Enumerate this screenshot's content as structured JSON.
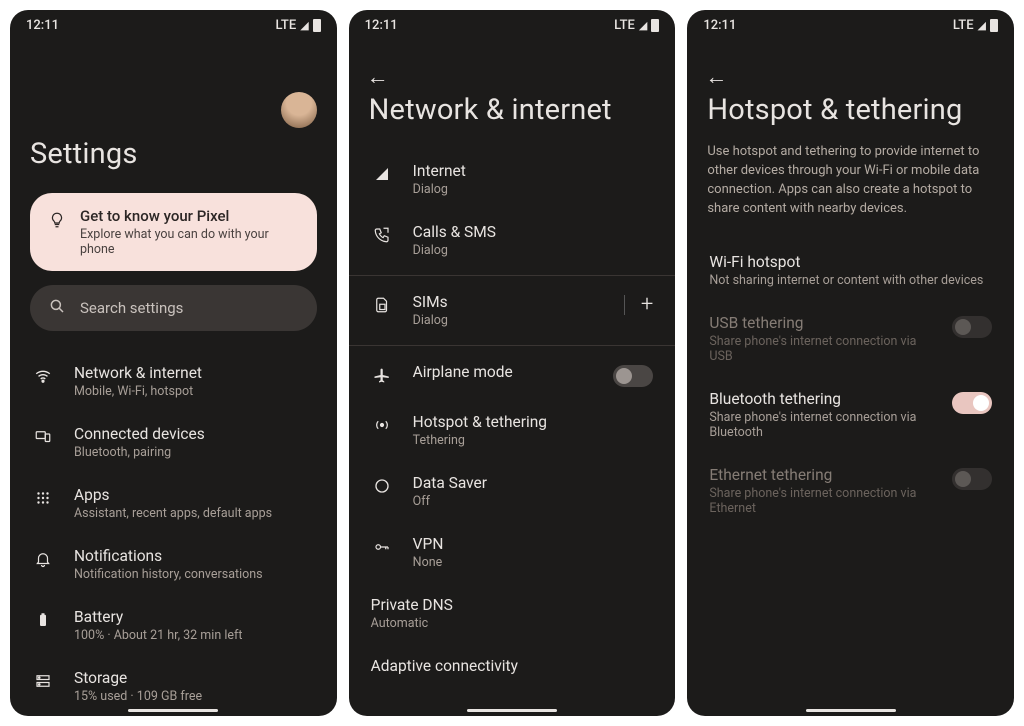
{
  "status": {
    "time": "12:11",
    "net": "LTE"
  },
  "screen1": {
    "title": "Settings",
    "promo": {
      "title": "Get to know your Pixel",
      "sub": "Explore what you can do with your phone"
    },
    "search_placeholder": "Search settings",
    "items": [
      {
        "title": "Network & internet",
        "sub": "Mobile, Wi-Fi, hotspot"
      },
      {
        "title": "Connected devices",
        "sub": "Bluetooth, pairing"
      },
      {
        "title": "Apps",
        "sub": "Assistant, recent apps, default apps"
      },
      {
        "title": "Notifications",
        "sub": "Notification history, conversations"
      },
      {
        "title": "Battery",
        "sub": "100% · About 21 hr, 32 min left"
      },
      {
        "title": "Storage",
        "sub": "15% used · 109 GB free"
      }
    ]
  },
  "screen2": {
    "title": "Network & internet",
    "items": [
      {
        "title": "Internet",
        "sub": "Dialog"
      },
      {
        "title": "Calls & SMS",
        "sub": "Dialog"
      },
      {
        "title": "SIMs",
        "sub": "Dialog"
      },
      {
        "title": "Airplane mode",
        "sub": ""
      },
      {
        "title": "Hotspot & tethering",
        "sub": "Tethering"
      },
      {
        "title": "Data Saver",
        "sub": "Off"
      },
      {
        "title": "VPN",
        "sub": "None"
      },
      {
        "title": "Private DNS",
        "sub": "Automatic"
      },
      {
        "title": "Adaptive connectivity",
        "sub": ""
      }
    ]
  },
  "screen3": {
    "title": "Hotspot & tethering",
    "desc": "Use hotspot and tethering to provide internet to other devices through your Wi-Fi or mobile data connection. Apps can also create a hotspot to share content with nearby devices.",
    "items": [
      {
        "title": "Wi-Fi hotspot",
        "sub": "Not sharing internet or content with other devices"
      },
      {
        "title": "USB tethering",
        "sub": "Share phone's internet connection via USB"
      },
      {
        "title": "Bluetooth tethering",
        "sub": "Share phone's internet connection via Bluetooth"
      },
      {
        "title": "Ethernet tethering",
        "sub": "Share phone's internet connection via Ethernet"
      }
    ]
  }
}
